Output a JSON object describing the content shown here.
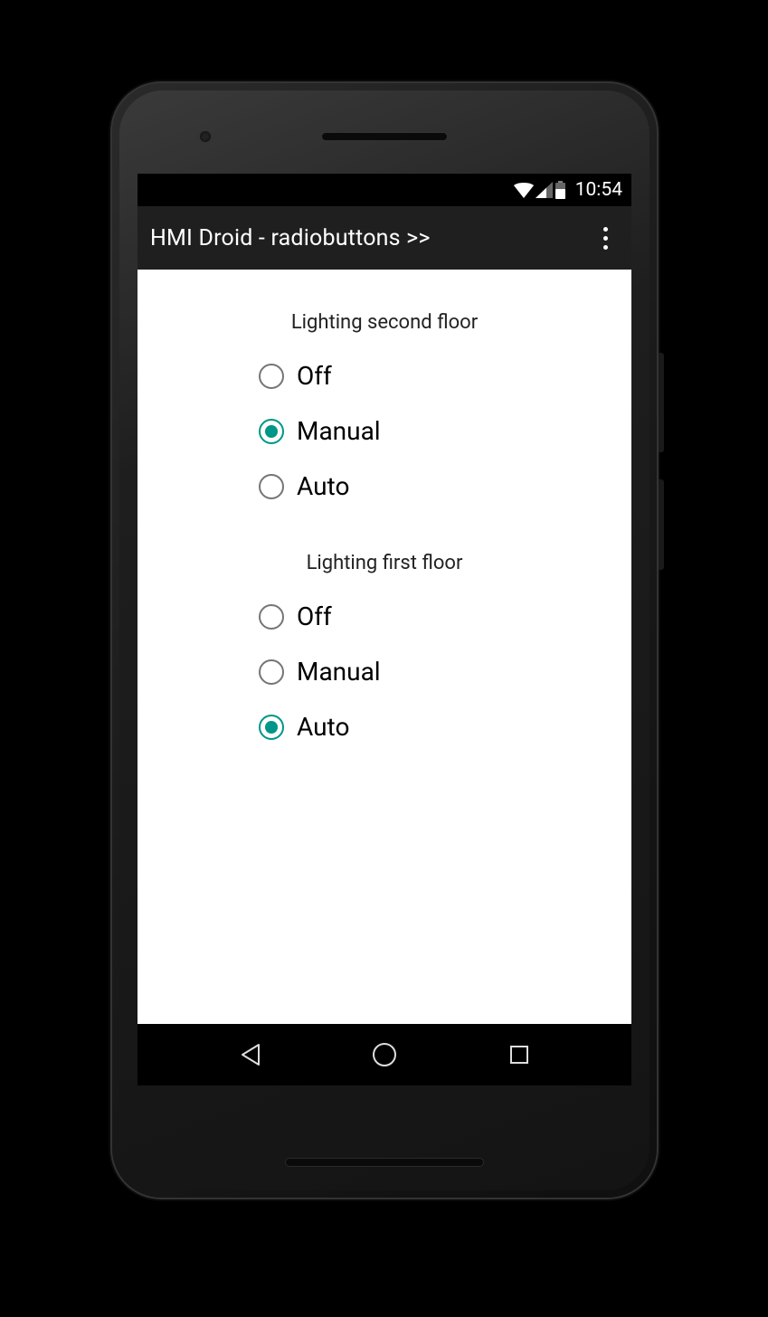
{
  "status": {
    "time": "10:54"
  },
  "appbar": {
    "title": "HMI Droid - radiobuttons >>"
  },
  "groups": [
    {
      "title": "Lighting second floor",
      "options": [
        {
          "label": "Off",
          "checked": false
        },
        {
          "label": "Manual",
          "checked": true
        },
        {
          "label": "Auto",
          "checked": false
        }
      ]
    },
    {
      "title": "Lighting first floor",
      "options": [
        {
          "label": "Off",
          "checked": false
        },
        {
          "label": "Manual",
          "checked": false
        },
        {
          "label": "Auto",
          "checked": true
        }
      ]
    }
  ],
  "colors": {
    "accent": "#009688"
  }
}
